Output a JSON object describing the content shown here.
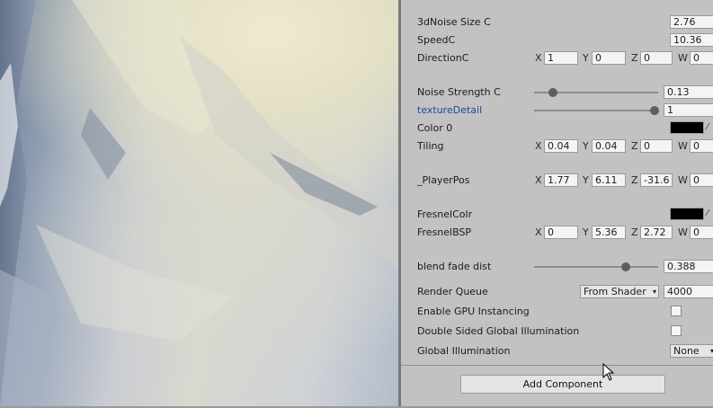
{
  "rows": {
    "noise_size_c": {
      "label": "3dNoise Size C",
      "value": "2.76"
    },
    "speed_c": {
      "label": "SpeedC",
      "value": "10.36"
    },
    "direction_c": {
      "label": "DirectionC",
      "x": "1",
      "y": "0",
      "z": "0",
      "w": "0"
    },
    "noise_strength_c": {
      "label": "Noise Strength C",
      "value": "0.13",
      "slider_fraction": 0.16
    },
    "texture_detail": {
      "label": "textureDetail",
      "value": "1",
      "slider_fraction": 1.0
    },
    "color_0": {
      "label": "Color 0",
      "color": "#000000"
    },
    "tiling": {
      "label": "Tiling",
      "x": "0.04",
      "y": "0.04",
      "z": "0",
      "w": "0"
    },
    "player_pos": {
      "label": "_PlayerPos",
      "x": "1.77",
      "y": "6.11",
      "z": "-31.6",
      "w": "0"
    },
    "fresnel_colr": {
      "label": "FresnelColr",
      "color": "#000000"
    },
    "fresnel_bsp": {
      "label": "FresnelBSP",
      "x": "0",
      "y": "5.36",
      "z": "2.72",
      "w": "0"
    },
    "blend_fade_dist": {
      "label": "blend fade dist",
      "value": "0.388",
      "slider_fraction": 0.76
    },
    "render_queue": {
      "label": "Render Queue",
      "mode": "From Shader",
      "value": "4000"
    },
    "gpu_instancing": {
      "label": "Enable GPU Instancing",
      "checked": false
    },
    "double_sided_gi": {
      "label": "Double Sided Global Illumination",
      "checked": false
    },
    "global_illumination": {
      "label": "Global Illumination",
      "value": "None"
    }
  },
  "axes": {
    "x": "X",
    "y": "Y",
    "z": "Z",
    "w": "W"
  },
  "add_component": "Add Component",
  "icons": {
    "picker": "eyedropper-icon",
    "caret": "▾"
  },
  "colors": {
    "inspector_bg": "#c2c2c2",
    "field_bg": "#f4f4f4",
    "label_highlight": "#1a4f95"
  }
}
